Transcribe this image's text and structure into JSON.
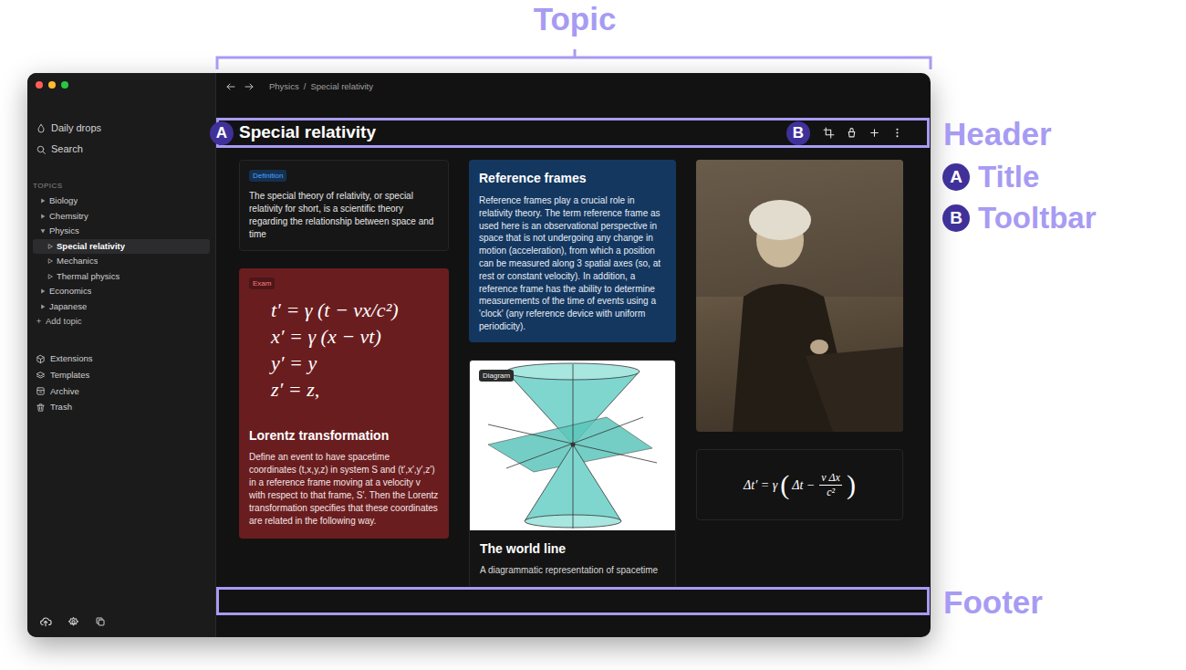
{
  "annotations": {
    "topic_label": "Topic",
    "header_label": "Header",
    "footer_label": "Footer",
    "markers": [
      {
        "badge": "A",
        "label": "Title"
      },
      {
        "badge": "B",
        "label": "Tooltbar"
      }
    ]
  },
  "sidebar": {
    "top_items": [
      "Daily drops",
      "Search"
    ],
    "topics_heading": "TOPICS",
    "topics": [
      {
        "label": "Biology",
        "expanded": false,
        "selected": false,
        "children": []
      },
      {
        "label": "Chemsitry",
        "expanded": false,
        "selected": false,
        "children": []
      },
      {
        "label": "Physics",
        "expanded": true,
        "selected": false,
        "children": [
          {
            "label": "Special relativity",
            "expanded": false,
            "selected": true
          },
          {
            "label": "Mechanics",
            "expanded": false,
            "selected": false
          },
          {
            "label": "Thermal physics",
            "expanded": false,
            "selected": false
          }
        ]
      },
      {
        "label": "Economics",
        "expanded": false,
        "selected": false,
        "children": []
      },
      {
        "label": "Japanese",
        "expanded": false,
        "selected": false,
        "children": []
      }
    ],
    "add_topic": {
      "icon": "+",
      "label": "Add topic"
    },
    "bottom_items": [
      "Extensions",
      "Templates",
      "Archive",
      "Trash"
    ]
  },
  "breadcrumb": {
    "items": [
      "Physics",
      "Special relativity"
    ],
    "separator": "/"
  },
  "header": {
    "title": "Special relativity"
  },
  "columns": [
    [
      {
        "kind": "definition",
        "tag": "Definition",
        "color": "#161616",
        "body": "The special theory of relativity, or special relativity for short, is a scientific theory regarding the relationship between space and time"
      },
      {
        "kind": "exam",
        "tag": "Exam",
        "color": "#6a1d1f",
        "formulas": [
          "t′ = γ (t − vx/c²)",
          "x′ = γ (x − vt)",
          "y′ = y",
          "z′ = z,"
        ],
        "title": "Lorentz transformation",
        "body": "Define an event to have spacetime coordinates (t,x,y,z) in system S and (t′,x′,y′,z′) in a reference frame moving at a velocity v with respect to that frame, S′. Then the Lorentz transformation specifies that these coordinates are related in the following way."
      }
    ],
    [
      {
        "kind": "note",
        "color": "#14375f",
        "title": "Reference frames",
        "body": "Reference frames play a crucial role in relativity theory. The term reference frame as used here is an observational perspective in space that is not undergoing any change in motion (acceleration), from which a position can be measured along 3 spatial axes (so, at rest or constant velocity). In addition, a reference frame has the ability to determine measurements of the time of events using a 'clock' (any reference device with uniform periodicity)."
      },
      {
        "kind": "diagram",
        "tag": "Diagram",
        "color": "#141414",
        "title": "The world line",
        "body": "A diagrammatic representation of spacetime"
      }
    ],
    [
      {
        "kind": "photo",
        "color": "#5a4c3a"
      },
      {
        "kind": "formula",
        "color": "#131313",
        "formula": {
          "lhs": "Δt′ = γ",
          "open": "(",
          "term": "Δt −",
          "numerator": "v Δx",
          "denominator": "c²",
          "close": ")"
        }
      }
    ]
  ]
}
